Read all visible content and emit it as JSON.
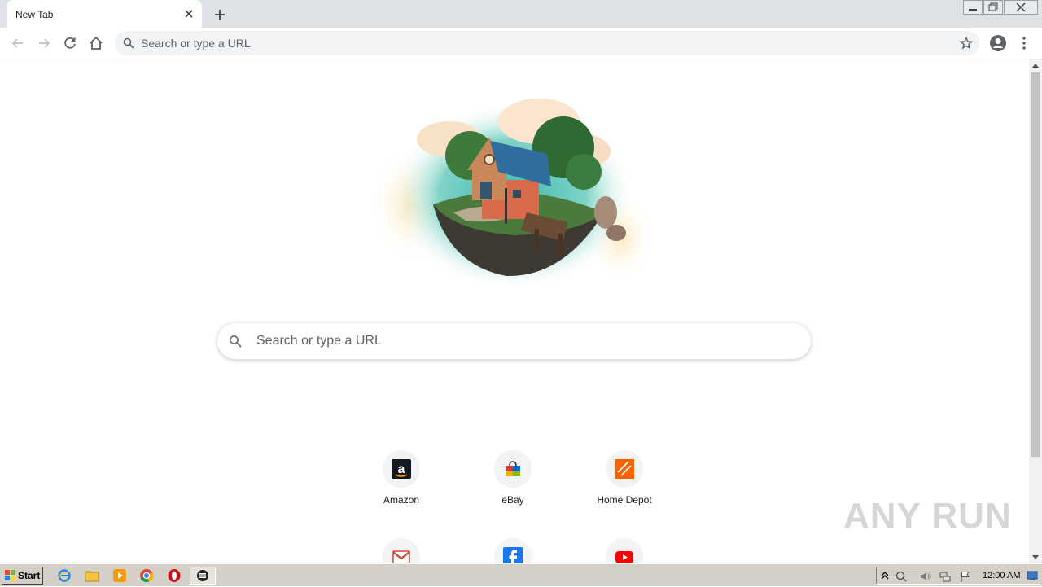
{
  "browser": {
    "tab_title": "New Tab",
    "omnibox_placeholder": "Search or type a URL"
  },
  "newtab": {
    "search_placeholder": "Search or type a URL",
    "shortcuts": [
      {
        "label": "Amazon",
        "icon": "amazon-icon"
      },
      {
        "label": "eBay",
        "icon": "ebay-icon"
      },
      {
        "label": "Home Depot",
        "icon": "home-depot-icon"
      },
      {
        "label": "",
        "icon": "gmail-icon"
      },
      {
        "label": "",
        "icon": "facebook-icon"
      },
      {
        "label": "",
        "icon": "youtube-icon"
      }
    ],
    "watermark": "ANY RUN"
  },
  "taskbar": {
    "start_label": "Start",
    "clock": "12:00 AM"
  },
  "colors": {
    "tabstrip": "#dee1e6",
    "omnibox": "#f1f3f4",
    "taskbar": "#d4d0c8",
    "youtube": "#ff0000",
    "facebook": "#1877f2",
    "home_depot": "#f96302"
  }
}
